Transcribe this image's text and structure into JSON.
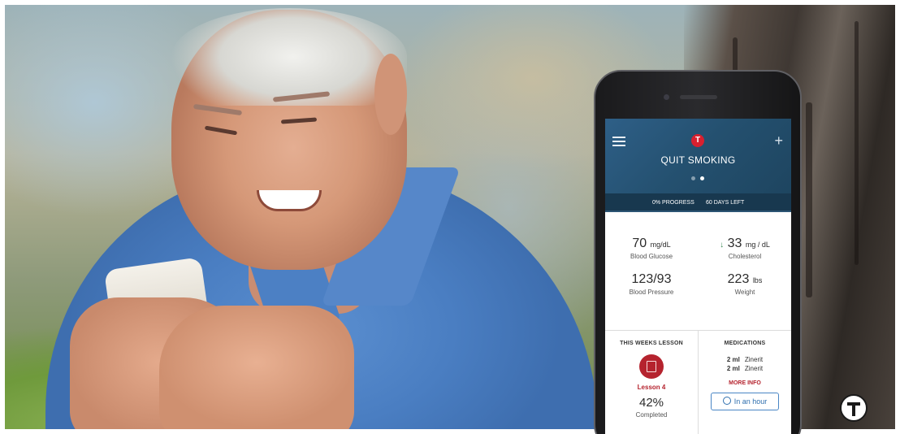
{
  "app": {
    "title": "QUIT SMOKING",
    "logo_letter": "T",
    "menu_icon": "hamburger-menu-icon",
    "add_icon": "plus-icon",
    "add_label": "+",
    "page_indicator": {
      "count": 2,
      "active": 1
    },
    "colors": {
      "header": "#24506f",
      "accent_red": "#b5232e",
      "link_blue": "#2f6fae"
    }
  },
  "progress": {
    "progress_label": "0% PROGRESS",
    "progress_value": 0,
    "days_left_label": "60 DAYS LEFT"
  },
  "stats": [
    {
      "value": "70",
      "unit": "mg/dL",
      "label": "Blood Glucose",
      "trend": ""
    },
    {
      "value": "33",
      "unit": "mg / dL",
      "label": "Cholesterol",
      "trend": "↓"
    },
    {
      "value": "123/93",
      "unit": "",
      "label": "Blood Pressure",
      "trend": ""
    },
    {
      "value": "223",
      "unit": "lbs",
      "label": "Weight",
      "trend": ""
    }
  ],
  "lesson": {
    "section_title": "THIS WEEKS LESSON",
    "name": "Lesson 4",
    "percent": "42%",
    "caption": "Completed"
  },
  "medications": {
    "section_title": "MEDICATIONS",
    "items": [
      {
        "dose": "2 ml",
        "name": "Zinerit"
      },
      {
        "dose": "2 ml",
        "name": "Zinerit"
      }
    ],
    "more_info_label": "MORE INFO",
    "reminder_label": "In an hour"
  }
}
